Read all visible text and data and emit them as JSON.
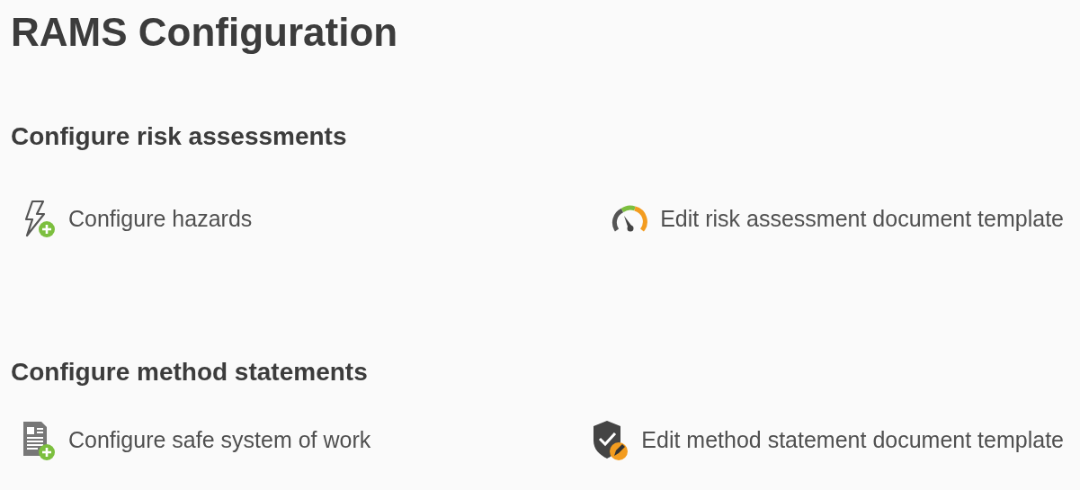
{
  "title": "RAMS Configuration",
  "sections": [
    {
      "heading": "Configure risk assessments",
      "links": [
        {
          "label": "Configure hazards",
          "kind": "hazard"
        },
        {
          "label": "Edit risk assessment document template",
          "kind": "gauge"
        }
      ]
    },
    {
      "heading": "Configure method statements",
      "links": [
        {
          "label": "Configure safe system of work",
          "kind": "document"
        },
        {
          "label": "Edit method statement document template",
          "kind": "shield"
        }
      ]
    }
  ]
}
